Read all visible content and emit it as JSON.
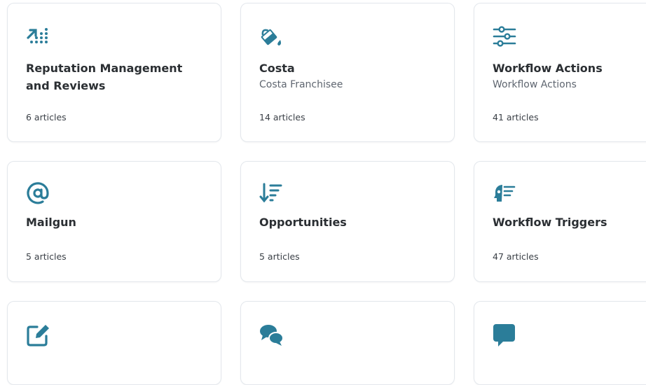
{
  "accent_color": "#2b7d99",
  "cards": [
    {
      "icon": "trending-chart-icon",
      "title": "Reputation Management and Reviews",
      "subtitle": "",
      "count": "6 articles"
    },
    {
      "icon": "paint-bucket-icon",
      "title": "Costa",
      "subtitle": "Costa Franchisee",
      "count": "14 articles"
    },
    {
      "icon": "sliders-icon",
      "title": "Workflow Actions",
      "subtitle": "Workflow Actions",
      "count": "41 articles"
    },
    {
      "icon": "at-sign-icon",
      "title": "Mailgun",
      "subtitle": "",
      "count": "5 articles"
    },
    {
      "icon": "sort-down-icon",
      "title": "Opportunities",
      "subtitle": "",
      "count": "5 articles"
    },
    {
      "icon": "trigger-head-icon",
      "title": "Workflow Triggers",
      "subtitle": "",
      "count": "47 articles"
    },
    {
      "icon": "edit-icon",
      "title": "",
      "subtitle": "",
      "count": ""
    },
    {
      "icon": "chat-bubbles-icon",
      "title": "",
      "subtitle": "",
      "count": ""
    },
    {
      "icon": "message-icon",
      "title": "",
      "subtitle": "",
      "count": ""
    }
  ]
}
